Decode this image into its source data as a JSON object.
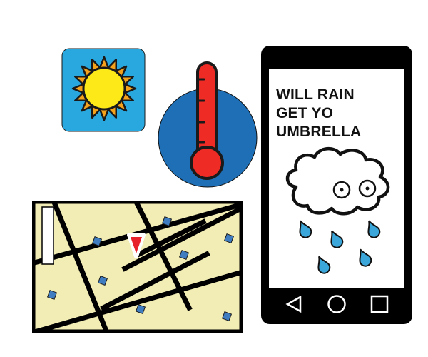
{
  "phone": {
    "message_lines": [
      "WILL RAIN",
      "GET YO",
      "UMBRELLA"
    ]
  },
  "icons": {
    "weather": "sun-icon",
    "temperature": "thermometer-icon",
    "map": "map-icon",
    "rain": "rain-cloud-icon"
  },
  "colors": {
    "sky_blue": "#29a8e0",
    "sun_yellow": "#fde917",
    "sun_orange": "#f4a21c",
    "thermo_blue": "#1e6fb5",
    "thermo_red": "#ee2b24",
    "map_land": "#f2edb5",
    "map_marker": "#3f7cc0",
    "pin_red": "#e8222a",
    "raindrop": "#3aa6d9"
  }
}
